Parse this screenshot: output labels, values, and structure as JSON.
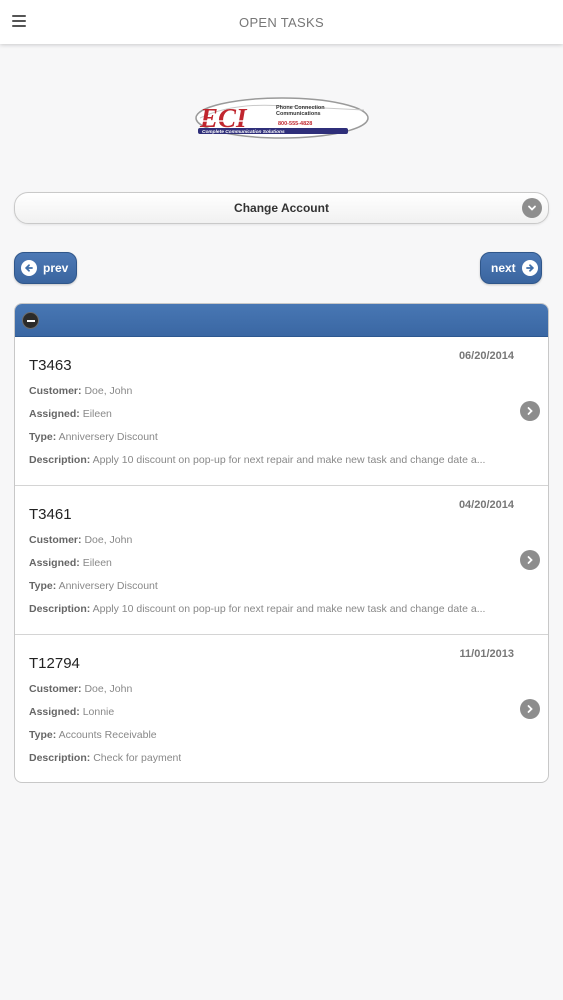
{
  "header": {
    "title": "OPEN TASKS",
    "menu_icon": "hamburger-menu-icon"
  },
  "logo": {
    "letters": "ECI",
    "company_line1": "Phone Connection",
    "company_line2": "Communications",
    "phone": "800-555-4828",
    "tagline": "Complete Communication Solutions"
  },
  "account_select": {
    "label": "Change Account",
    "icon": "chevron-down-icon"
  },
  "nav": {
    "prev_label": "prev",
    "next_label": "next",
    "prev_icon": "arrow-left-icon",
    "next_icon": "arrow-right-icon"
  },
  "colors": {
    "accent": "#3f6ea9",
    "background": "#f7f7f8"
  },
  "labels": {
    "customer": "Customer:",
    "assigned": "Assigned:",
    "type": "Type:",
    "description": "Description:"
  },
  "tasks": [
    {
      "id": "T3463",
      "date": "06/20/2014",
      "customer": "Doe, John",
      "assigned": "Eileen",
      "type": "Anniversery Discount",
      "description": "Apply 10 discount on pop-up for next repair and make new task and change date a..."
    },
    {
      "id": "T3461",
      "date": "04/20/2014",
      "customer": "Doe, John",
      "assigned": "Eileen",
      "type": "Anniversery Discount",
      "description": "Apply 10 discount on pop-up for next repair and make new task and change date a..."
    },
    {
      "id": "T12794",
      "date": "11/01/2013",
      "customer": "Doe, John",
      "assigned": "Lonnie",
      "type": "Accounts Receivable",
      "description": "Check for payment"
    }
  ]
}
